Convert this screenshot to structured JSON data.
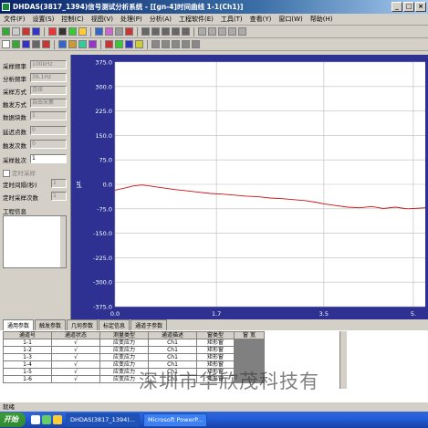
{
  "window": {
    "title": "DHDAS(3817_1394)信号测试分析系统 - [[gn-4]时间曲线  1-1(Ch1)]"
  },
  "menu": [
    "文件(F)",
    "设置(S)",
    "控制(C)",
    "视图(V)",
    "处理(P)",
    "分析(A)",
    "工程软件(E)",
    "工具(T)",
    "查看(Y)",
    "窗口(W)",
    "帮助(H)"
  ],
  "left_panel": {
    "fields": [
      {
        "label": "采样频率",
        "value": "100kHz"
      },
      {
        "label": "分析频率",
        "value": "39.1Hz"
      },
      {
        "label": "采样方式",
        "value": "连续"
      },
      {
        "label": "触发方式",
        "value": "自由采集"
      },
      {
        "label": "数据块数",
        "value": "1"
      },
      {
        "label": "延迟点数",
        "value": "0"
      },
      {
        "label": "触发次数",
        "value": "0"
      },
      {
        "label": "采样批次",
        "value": "1"
      }
    ],
    "timed_checkbox": "定时采样",
    "interval_label": "定时间隔(秒)",
    "interval_value": "1",
    "count_label": "定时采样次数",
    "count_value": "1",
    "project_info_label": "工程信息"
  },
  "chart_data": {
    "type": "line",
    "ylabel": "με",
    "ylim": [
      -375.0,
      375.0
    ],
    "yticks": [
      "375.0",
      "300.0",
      "225.0",
      "150.0",
      "75.0",
      "0.0",
      "-75.0",
      "-150.0",
      "-225.0",
      "-300.0",
      "-375.0"
    ],
    "xlim": [
      0.0,
      5.2
    ],
    "xticks": [
      "0.0",
      "1.7",
      "3.5",
      "5."
    ],
    "series": [
      {
        "color": "#cc1111",
        "x": [
          0,
          0.15,
          0.3,
          0.45,
          0.55,
          0.7,
          0.85,
          1.0,
          1.2,
          1.4,
          1.6,
          1.8,
          2.0,
          2.2,
          2.4,
          2.6,
          2.8,
          3.0,
          3.2,
          3.4,
          3.5,
          3.7,
          3.9,
          4.1,
          4.3,
          4.5,
          4.7,
          4.9,
          5.1,
          5.2
        ],
        "y": [
          -18,
          -12,
          -5,
          -2,
          -4,
          -8,
          -12,
          -16,
          -20,
          -24,
          -28,
          -30,
          -33,
          -36,
          -38,
          -42,
          -44,
          -47,
          -50,
          -56,
          -60,
          -65,
          -70,
          -72,
          -68,
          -74,
          -70,
          -75,
          -73,
          -72
        ]
      }
    ]
  },
  "tabs": [
    "通用参数",
    "触发参数",
    "几何参数",
    "标定信息",
    "通道子参数"
  ],
  "table": {
    "headers": [
      "通道号",
      "通道状态",
      "测量类型",
      "通道描述",
      "窗类型",
      "窗 宽"
    ],
    "rows": [
      [
        "1-1",
        "√",
        "应变应力",
        "Ch1",
        "矩形窗",
        ""
      ],
      [
        "1-2",
        "√",
        "应变应力",
        "Ch1",
        "矩形窗",
        ""
      ],
      [
        "1-3",
        "√",
        "应变应力",
        "Ch1",
        "矩形窗",
        ""
      ],
      [
        "1-4",
        "√",
        "应变应力",
        "Ch1",
        "矩形窗",
        ""
      ],
      [
        "1-5",
        "√",
        "应变应力",
        "Ch1",
        "矩形窗",
        ""
      ],
      [
        "1-6",
        "√",
        "应变应力",
        "Ch1",
        "矩形窗",
        ""
      ]
    ]
  },
  "watermark": "深圳市华欣茂科技有",
  "status": "就绪",
  "taskbar": {
    "start": "开始",
    "tasks": [
      "DHDAS(3817_1394)...",
      "Microsoft PowerP..."
    ]
  },
  "colors": {
    "chart_bg": "#2e3192",
    "plot_bg": "#ffffff",
    "grid": "#bbbbbb",
    "line": "#cc1111",
    "title_bar": "#0a246a"
  }
}
